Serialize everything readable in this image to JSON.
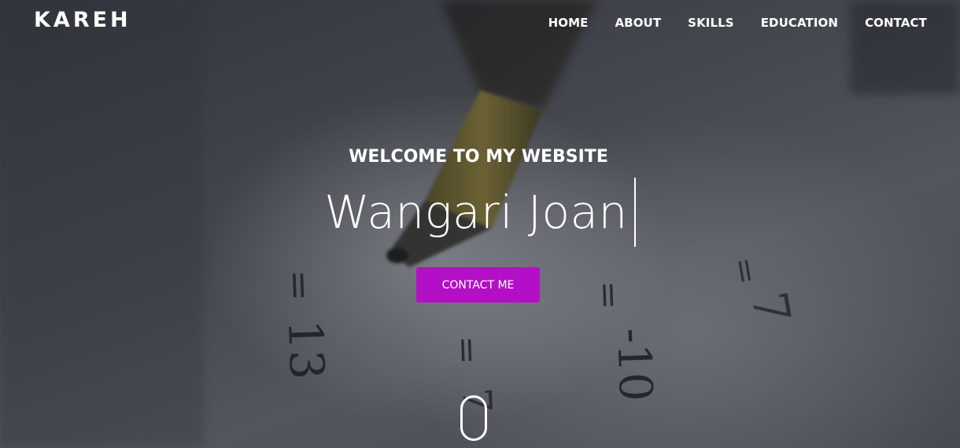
{
  "header": {
    "logo": "KAREH",
    "nav": [
      {
        "label": "HOME"
      },
      {
        "label": "ABOUT"
      },
      {
        "label": "SKILLS"
      },
      {
        "label": "EDUCATION"
      },
      {
        "label": "CONTACT"
      }
    ]
  },
  "hero": {
    "welcome": "WELCOME TO MY WEBSITE",
    "name": "Wangari Joan",
    "cta_label": "CONTACT ME",
    "background_glyphs": [
      "=",
      "13",
      "=",
      "7",
      "=",
      "-10",
      "=",
      "7"
    ]
  },
  "colors": {
    "accent": "#b30fc6",
    "text": "#ffffff"
  },
  "icons": {
    "scroll": "mouse-scroll-icon"
  }
}
